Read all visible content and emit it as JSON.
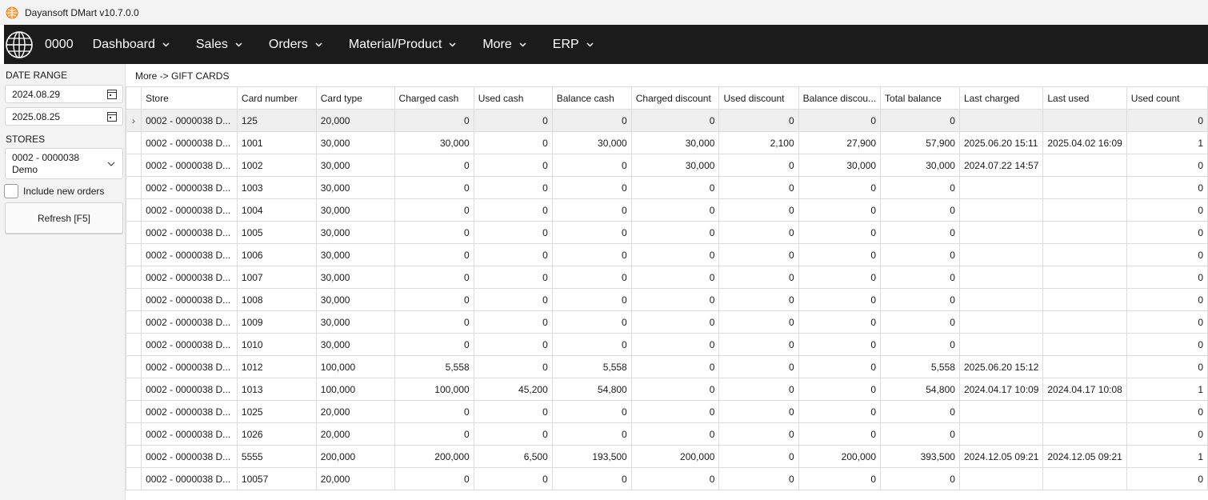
{
  "window": {
    "title": "Dayansoft DMart v10.7.0.0"
  },
  "nav": {
    "code": "0000",
    "items": [
      {
        "label": "Dashboard",
        "name": "dashboard"
      },
      {
        "label": "Sales",
        "name": "sales"
      },
      {
        "label": "Orders",
        "name": "orders"
      },
      {
        "label": "Material/Product",
        "name": "material-product"
      },
      {
        "label": "More",
        "name": "more"
      },
      {
        "label": "ERP",
        "name": "erp"
      }
    ]
  },
  "sidebar": {
    "date_range_label": "DATE RANGE",
    "date_from": "2024.08.29",
    "date_to": "2025.08.25",
    "stores_label": "STORES",
    "store_line1": "0002 - 0000038",
    "store_line2": "Demo",
    "include_new_orders_label": "Include new orders",
    "refresh_label": "Refresh [F5]"
  },
  "breadcrumb": "More -> GIFT CARDS",
  "table": {
    "columns": [
      "Store",
      "Card number",
      "Card type",
      "Charged cash",
      "Used cash",
      "Balance cash",
      "Charged discount",
      "Used discount",
      "Balance discou...",
      "Total balance",
      "Last charged",
      "Last used",
      "Used count"
    ],
    "selected_marker": "›",
    "rows": [
      [
        "0002 - 0000038 D...",
        "125",
        "20,000",
        "0",
        "0",
        "0",
        "0",
        "0",
        "0",
        "0",
        "",
        "",
        "0"
      ],
      [
        "0002 - 0000038 D...",
        "1001",
        "30,000",
        "30,000",
        "0",
        "30,000",
        "30,000",
        "2,100",
        "27,900",
        "57,900",
        "2025.06.20 15:11",
        "2025.04.02 16:09",
        "1"
      ],
      [
        "0002 - 0000038 D...",
        "1002",
        "30,000",
        "0",
        "0",
        "0",
        "30,000",
        "0",
        "30,000",
        "30,000",
        "2024.07.22 14:57",
        "",
        "0"
      ],
      [
        "0002 - 0000038 D...",
        "1003",
        "30,000",
        "0",
        "0",
        "0",
        "0",
        "0",
        "0",
        "0",
        "",
        "",
        "0"
      ],
      [
        "0002 - 0000038 D...",
        "1004",
        "30,000",
        "0",
        "0",
        "0",
        "0",
        "0",
        "0",
        "0",
        "",
        "",
        "0"
      ],
      [
        "0002 - 0000038 D...",
        "1005",
        "30,000",
        "0",
        "0",
        "0",
        "0",
        "0",
        "0",
        "0",
        "",
        "",
        "0"
      ],
      [
        "0002 - 0000038 D...",
        "1006",
        "30,000",
        "0",
        "0",
        "0",
        "0",
        "0",
        "0",
        "0",
        "",
        "",
        "0"
      ],
      [
        "0002 - 0000038 D...",
        "1007",
        "30,000",
        "0",
        "0",
        "0",
        "0",
        "0",
        "0",
        "0",
        "",
        "",
        "0"
      ],
      [
        "0002 - 0000038 D...",
        "1008",
        "30,000",
        "0",
        "0",
        "0",
        "0",
        "0",
        "0",
        "0",
        "",
        "",
        "0"
      ],
      [
        "0002 - 0000038 D...",
        "1009",
        "30,000",
        "0",
        "0",
        "0",
        "0",
        "0",
        "0",
        "0",
        "",
        "",
        "0"
      ],
      [
        "0002 - 0000038 D...",
        "1010",
        "30,000",
        "0",
        "0",
        "0",
        "0",
        "0",
        "0",
        "0",
        "",
        "",
        "0"
      ],
      [
        "0002 - 0000038 D...",
        "1012",
        "100,000",
        "5,558",
        "0",
        "5,558",
        "0",
        "0",
        "0",
        "5,558",
        "2025.06.20 15:12",
        "",
        "0"
      ],
      [
        "0002 - 0000038 D...",
        "1013",
        "100,000",
        "100,000",
        "45,200",
        "54,800",
        "0",
        "0",
        "0",
        "54,800",
        "2024.04.17 10:09",
        "2024.04.17 10:08",
        "1"
      ],
      [
        "0002 - 0000038 D...",
        "1025",
        "20,000",
        "0",
        "0",
        "0",
        "0",
        "0",
        "0",
        "0",
        "",
        "",
        "0"
      ],
      [
        "0002 - 0000038 D...",
        "1026",
        "20,000",
        "0",
        "0",
        "0",
        "0",
        "0",
        "0",
        "0",
        "",
        "",
        "0"
      ],
      [
        "0002 - 0000038 D...",
        "5555",
        "200,000",
        "200,000",
        "6,500",
        "193,500",
        "200,000",
        "0",
        "200,000",
        "393,500",
        "2024.12.05 09:21",
        "2024.12.05 09:21",
        "1"
      ],
      [
        "0002 - 0000038 D...",
        "10057",
        "20,000",
        "0",
        "0",
        "0",
        "0",
        "0",
        "0",
        "0",
        "",
        "",
        "0"
      ]
    ]
  }
}
